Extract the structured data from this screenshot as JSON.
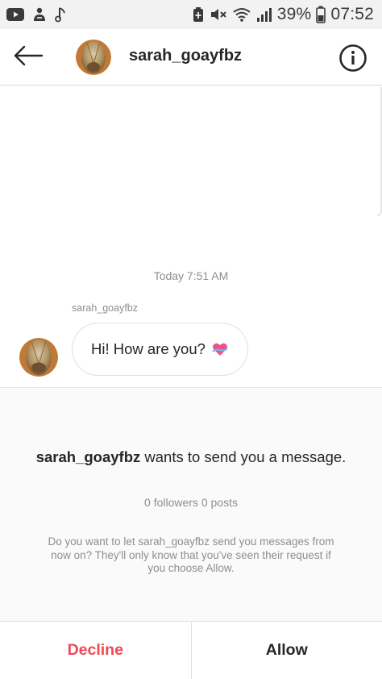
{
  "status_bar": {
    "left_icons": [
      "youtube-icon",
      "hand-notification-icon",
      "music-note-icon"
    ],
    "right_icons": [
      "battery-saver-icon",
      "mute-icon",
      "wifi-icon",
      "signal-icon",
      "battery-icon"
    ],
    "battery_percent": "39%",
    "time": "07:52"
  },
  "header": {
    "username": "sarah_goayfbz",
    "back_icon": "back-arrow-icon",
    "info_icon": "info-icon"
  },
  "conversation": {
    "timestamp": "Today 7:51 AM",
    "sender_name": "sarah_goayfbz",
    "message_text": "Hi! How are you?",
    "message_emoji": "heart-with-ribbon-icon"
  },
  "request": {
    "username": "sarah_goayfbz",
    "title_suffix": " wants to send you a message.",
    "stats": "0 followers 0 posts",
    "description": "Do you want to let sarah_goayfbz send you messages from now on? They'll only know that you've seen their request if you choose Allow."
  },
  "footer": {
    "decline_label": "Decline",
    "allow_label": "Allow"
  },
  "colors": {
    "decline": "#ed4956",
    "secondary_text": "#8e8e8e",
    "primary_text": "#262626",
    "status_bar_bg": "#f2f2f2"
  }
}
